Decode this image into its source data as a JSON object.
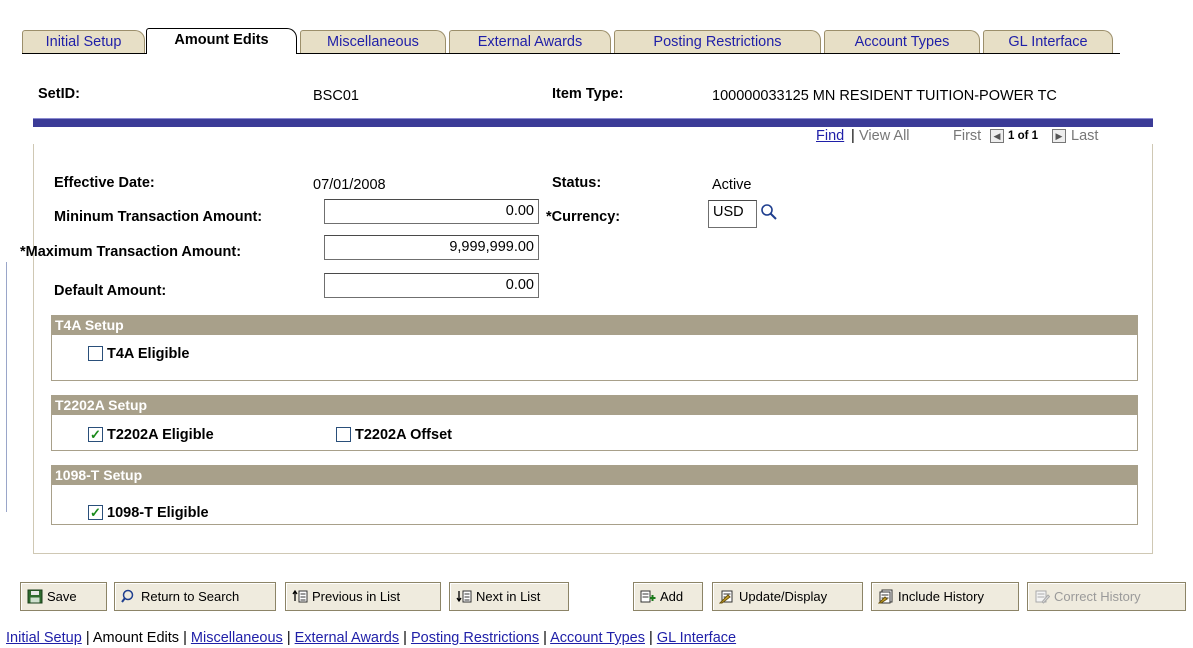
{
  "tabs": [
    {
      "label": "Initial Setup",
      "active": false
    },
    {
      "label": "Amount Edits",
      "active": true
    },
    {
      "label": "Miscellaneous",
      "active": false
    },
    {
      "label": "External Awards",
      "active": false
    },
    {
      "label": "Posting Restrictions",
      "active": false
    },
    {
      "label": "Account Types",
      "active": false
    },
    {
      "label": "GL Interface",
      "active": false
    }
  ],
  "header": {
    "setid_label": "SetID:",
    "setid_value": "BSC01",
    "itemtype_label": "Item Type:",
    "itemtype_value": "100000033125  MN RESIDENT TUITION-POWER TC"
  },
  "nav": {
    "find": "Find",
    "separator": "|",
    "view_all": "View All",
    "first": "First",
    "position": "1 of 1",
    "last": "Last"
  },
  "form": {
    "effective_date_label": "Effective Date:",
    "effective_date_value": "07/01/2008",
    "status_label": "Status:",
    "status_value": "Active",
    "min_amount_label": "Mininum Transaction Amount:",
    "min_amount_value": "0.00",
    "currency_label": "*Currency:",
    "currency_value": "USD",
    "max_amount_label": "*Maximum Transaction Amount:",
    "max_amount_value": "9,999,999.00",
    "default_amount_label": "Default Amount:",
    "default_amount_value": "0.00"
  },
  "groups": {
    "t4a": {
      "title": "T4A Setup",
      "eligible_label": "T4A Eligible",
      "eligible_checked": false
    },
    "t2202a": {
      "title": "T2202A Setup",
      "eligible_label": "T2202A Eligible",
      "eligible_checked": true,
      "offset_label": "T2202A Offset",
      "offset_checked": false
    },
    "t1098": {
      "title": "1098-T Setup",
      "eligible_label": "1098-T Eligible",
      "eligible_checked": true
    }
  },
  "buttons": {
    "save": "Save",
    "return_to_search": "Return to Search",
    "previous_in_list": "Previous in List",
    "next_in_list": "Next in List",
    "add": "Add",
    "update_display": "Update/Display",
    "include_history": "Include History",
    "correct_history": "Correct History"
  },
  "footer_links": [
    "Initial Setup",
    "Amount Edits",
    "Miscellaneous",
    "External Awards",
    "Posting Restrictions",
    "Account Types",
    "GL Interface"
  ],
  "colors": {
    "blue_bar": "#3b3b97",
    "group_header": "#a8a08a",
    "tab_inactive": "#e7dfc6",
    "link": "#1f1fa8"
  }
}
